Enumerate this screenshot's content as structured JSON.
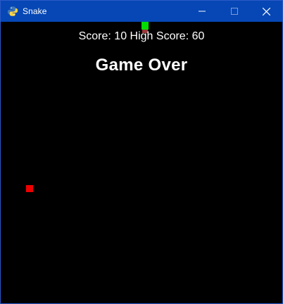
{
  "window": {
    "title": "Snake",
    "icon": "python-icon",
    "controls": {
      "minimize_icon": "minimize-icon",
      "maximize_icon": "maximize-icon",
      "close_icon": "close-icon"
    },
    "titlebar_color": "#0647b5",
    "background_color": "#000000"
  },
  "game": {
    "score_text": "Score: 10 High Score: 60",
    "status_text": "Game Over",
    "score": 10,
    "high_score": 60,
    "text_color": "#ffffff",
    "snake_color": "#00dd00",
    "food_color": "#ee0000"
  }
}
